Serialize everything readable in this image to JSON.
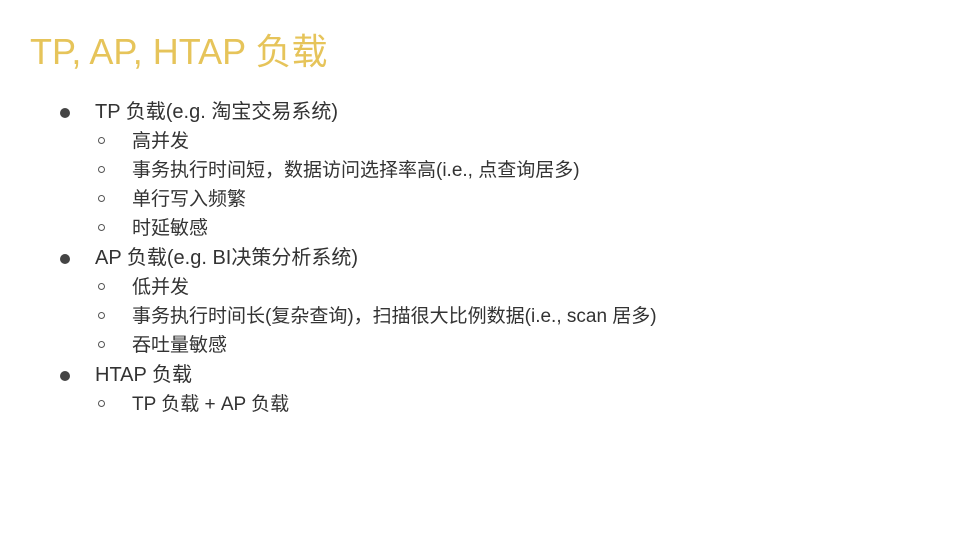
{
  "slide": {
    "title": "TP, AP, HTAP 负载",
    "sections": [
      {
        "label": "TP 负载(e.g. 淘宝交易系统)",
        "items": [
          "高并发",
          "事务执行时间短，数据访问选择率高(i.e., 点查询居多)",
          "单行写入频繁",
          "时延敏感"
        ]
      },
      {
        "label": "AP 负载(e.g. BI决策分析系统)",
        "items": [
          "低并发",
          "事务执行时间长(复杂查询)，扫描很大比例数据(i.e., scan 居多)",
          "吞吐量敏感"
        ]
      },
      {
        "label": "HTAP 负载",
        "items": [
          "TP 负载 + AP 负载"
        ]
      }
    ]
  }
}
